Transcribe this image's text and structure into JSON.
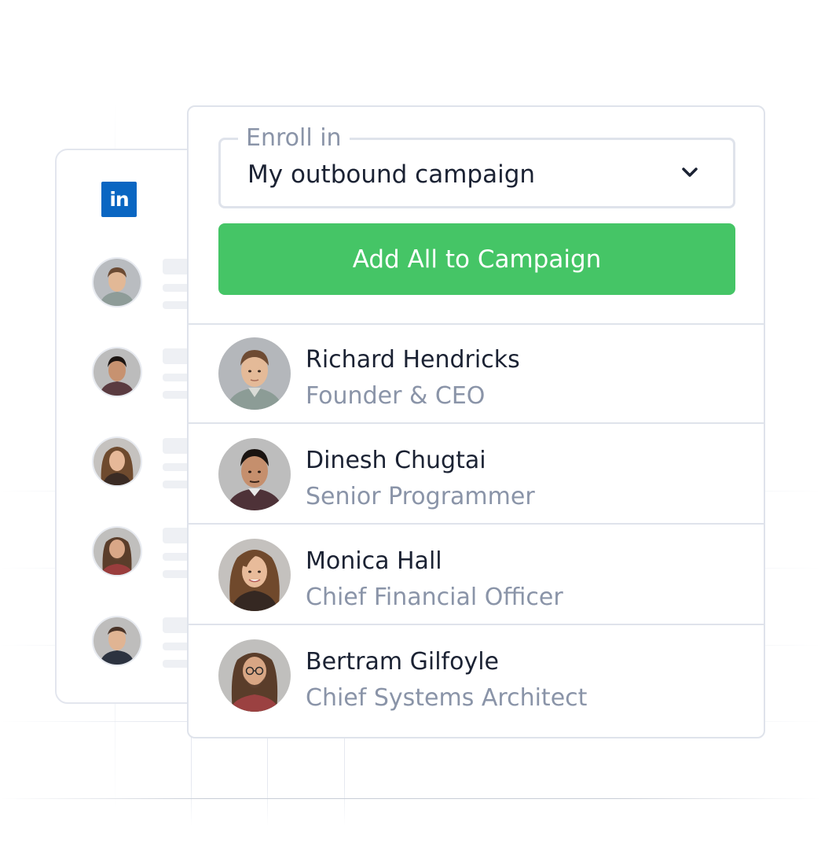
{
  "background_card": {
    "logo_text": "in",
    "logo_color": "#0a66c2",
    "avatar_count": 5
  },
  "enroll": {
    "legend": "Enroll in",
    "selected_value": "My outbound campaign",
    "chevron_icon": "chevron-down-icon"
  },
  "add_button": {
    "label": "Add All to Campaign",
    "color": "#45c566"
  },
  "contacts": [
    {
      "name": "Richard Hendricks",
      "title": "Founder & CEO"
    },
    {
      "name": "Dinesh Chugtai",
      "title": "Senior Programmer"
    },
    {
      "name": "Monica Hall",
      "title": "Chief Financial Officer"
    },
    {
      "name": "Bertram Gilfoyle",
      "title": "Chief Systems Architect"
    }
  ],
  "colors": {
    "name_text": "#1b2233",
    "title_text": "#8a94a8",
    "border": "#dfe3eb"
  }
}
